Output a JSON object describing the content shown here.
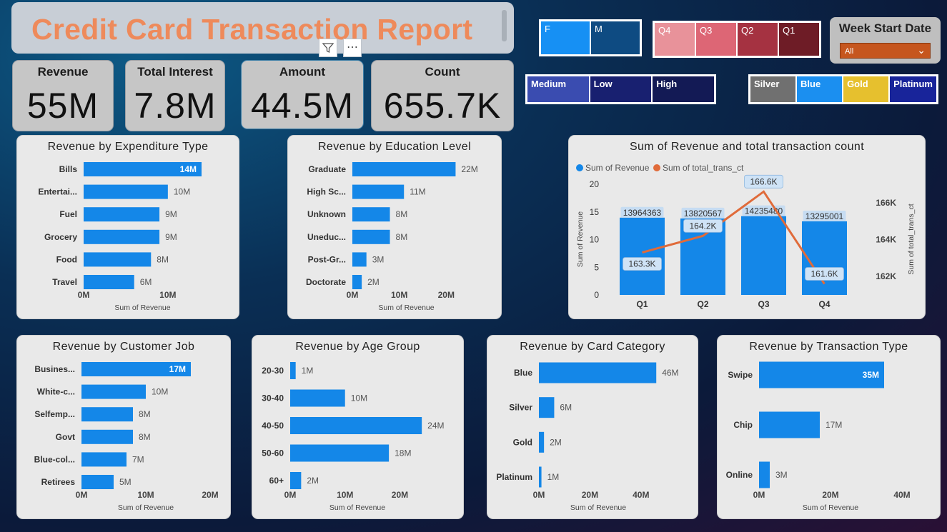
{
  "header": {
    "title": "Credit Card Transaction Report",
    "filter_icon": "filter-icon",
    "more_icon": "more-options-icon"
  },
  "kpis": [
    {
      "label": "Revenue",
      "value": "55M"
    },
    {
      "label": "Total Interest",
      "value": "7.8M"
    },
    {
      "label": "Amount",
      "value": "44.5M"
    },
    {
      "label": "Count",
      "value": "655.7K"
    }
  ],
  "slicers": {
    "gender": [
      {
        "label": "F",
        "color": "#1690f4"
      },
      {
        "label": "M",
        "color": "#0e4b82"
      }
    ],
    "quarter": [
      {
        "label": "Q4",
        "color": "#e8929a"
      },
      {
        "label": "Q3",
        "color": "#dd6675"
      },
      {
        "label": "Q2",
        "color": "#a53241"
      },
      {
        "label": "Q1",
        "color": "#6e1c26"
      }
    ],
    "income": [
      {
        "label": "Medium",
        "color": "#3a4cb0"
      },
      {
        "label": "Low",
        "color": "#182070"
      },
      {
        "label": "High",
        "color": "#131a55"
      }
    ],
    "card": [
      {
        "label": "Silver",
        "color": "#707070"
      },
      {
        "label": "Blue",
        "color": "#1b8ff0"
      },
      {
        "label": "Gold",
        "color": "#e6c02e"
      },
      {
        "label": "Platinum",
        "color": "#18249a"
      }
    ],
    "week": {
      "label": "Week Start Date",
      "value": "All"
    }
  },
  "chart_data": [
    {
      "type": "bar",
      "title": "Revenue by Expenditure Type",
      "categories": [
        "Bills",
        "Entertai...",
        "Fuel",
        "Grocery",
        "Food",
        "Travel"
      ],
      "values": [
        14,
        10,
        9,
        9,
        8,
        6
      ],
      "data_labels": [
        "14M",
        "10M",
        "9M",
        "9M",
        "8M",
        "6M"
      ],
      "xlabel": "Sum of Revenue",
      "ylabel": "",
      "xticks": [
        "0M",
        "10M"
      ],
      "xlim": [
        0,
        14
      ],
      "inside_label_first": true
    },
    {
      "type": "bar",
      "title": "Revenue by Education Level",
      "categories": [
        "Graduate",
        "High Sc...",
        "Unknown",
        "Uneduc...",
        "Post-Gr...",
        "Doctorate"
      ],
      "values": [
        22,
        11,
        8,
        8,
        3,
        2
      ],
      "data_labels": [
        "22M",
        "11M",
        "8M",
        "8M",
        "3M",
        "2M"
      ],
      "xlabel": "Sum of Revenue",
      "ylabel": "",
      "xticks": [
        "0M",
        "10M",
        "20M"
      ],
      "xlim": [
        0,
        23
      ],
      "inside_label_first": false
    },
    {
      "type": "bar+line",
      "title": "Sum of Revenue and total transaction count",
      "categories": [
        "Q1",
        "Q2",
        "Q3",
        "Q4"
      ],
      "series": [
        {
          "name": "Sum of Revenue",
          "values": [
            13964363,
            13820567,
            14235480,
            13295001
          ],
          "labels": [
            "13964363",
            "13820567",
            "14235480",
            "13295001"
          ],
          "color": "#1487e8"
        },
        {
          "name": "Sum of total_trans_ct",
          "values": [
            163.3,
            164.2,
            166.6,
            161.6
          ],
          "labels": [
            "163.3K",
            "164.2K",
            "166.6K",
            "161.6K"
          ],
          "color": "#e06b3a"
        }
      ],
      "ylabel": "Sum of Revenue",
      "y2label": "Sum of total_trans_ct",
      "yticks": [
        "0",
        "5",
        "10",
        "15",
        "20"
      ],
      "ylim": [
        0,
        20
      ],
      "y2ticks": [
        "162K",
        "164K",
        "166K"
      ],
      "y2lim": [
        161,
        167
      ],
      "legend": "top-left"
    },
    {
      "type": "bar",
      "title": "Revenue by Customer Job",
      "categories": [
        "Busines...",
        "White-c...",
        "Selfemp...",
        "Govt",
        "Blue-col...",
        "Retirees"
      ],
      "values": [
        17,
        10,
        8,
        8,
        7,
        5
      ],
      "data_labels": [
        "17M",
        "10M",
        "8M",
        "8M",
        "7M",
        "5M"
      ],
      "xlabel": "Sum of Revenue",
      "ylabel": "",
      "xticks": [
        "0M",
        "10M",
        "20M"
      ],
      "xlim": [
        0,
        20
      ],
      "inside_label_first": true
    },
    {
      "type": "bar",
      "title": "Revenue by Age Group",
      "categories": [
        "20-30",
        "30-40",
        "40-50",
        "50-60",
        "60+"
      ],
      "values": [
        1,
        10,
        24,
        18,
        2
      ],
      "data_labels": [
        "1M",
        "10M",
        "24M",
        "18M",
        "2M"
      ],
      "xlabel": "Sum of Revenue",
      "ylabel": "",
      "xticks": [
        "0M",
        "10M",
        "20M"
      ],
      "xlim": [
        0,
        24.5
      ],
      "inside_label_first": false
    },
    {
      "type": "bar",
      "title": "Revenue by Card Category",
      "categories": [
        "Blue",
        "Silver",
        "Gold",
        "Platinum"
      ],
      "values": [
        46,
        6,
        2,
        1
      ],
      "data_labels": [
        "46M",
        "6M",
        "2M",
        "1M"
      ],
      "xlabel": "Sum of Revenue",
      "ylabel": "",
      "xticks": [
        "0M",
        "20M",
        "40M"
      ],
      "xlim": [
        0,
        46.5
      ],
      "inside_label_first": false
    },
    {
      "type": "bar",
      "title": "Revenue by Transaction Type",
      "categories": [
        "Swipe",
        "Chip",
        "Online"
      ],
      "values": [
        35,
        17,
        3
      ],
      "data_labels": [
        "35M",
        "17M",
        "3M"
      ],
      "xlabel": "Sum of Revenue",
      "ylabel": "",
      "xticks": [
        "0M",
        "20M",
        "40M"
      ],
      "xlim": [
        0,
        40
      ],
      "inside_label_first": true
    }
  ]
}
